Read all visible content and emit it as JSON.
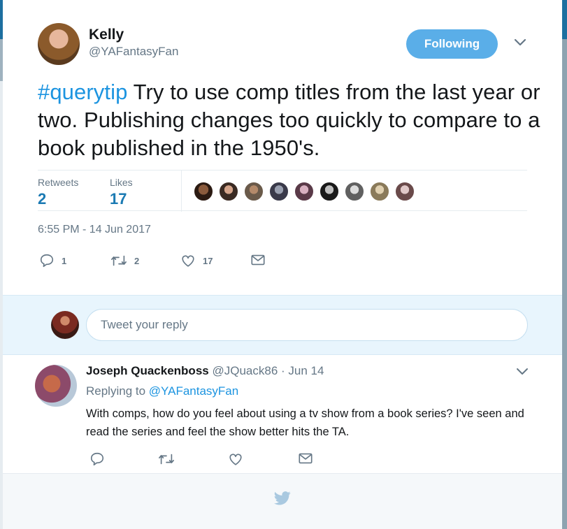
{
  "tweet": {
    "author_name": "Kelly",
    "author_handle": "@YAFantasyFan",
    "follow_button": "Following",
    "hashtag": "#querytip",
    "text": " Try to use comp titles from the last year or two. Publishing changes too quickly to compare to a book published in the 1950's.",
    "retweets_label": "Retweets",
    "retweets_count": "2",
    "likes_label": "Likes",
    "likes_count": "17",
    "likers_count": 9,
    "timestamp": "6:55 PM - 14 Jun 2017",
    "actions": {
      "reply_count": "1",
      "retweet_count": "2",
      "like_count": "17"
    }
  },
  "reply_box": {
    "placeholder": "Tweet your reply"
  },
  "reply": {
    "author_name": "Joseph Quackenboss",
    "author_handle": "@JQuack86",
    "separator": "·",
    "date": "Jun 14",
    "replying_prefix": "Replying to ",
    "replying_to": "@YAFantasyFan",
    "text": "With comps, how do you feel about using a tv show from a book series? I've seen and read the series and feel the show better hits the TA."
  },
  "colors": {
    "accent": "#1c94e0",
    "follow_button": "#5aaee8",
    "muted_text": "#657786",
    "stat_count": "#1b7ab3"
  },
  "icons": [
    "chevron-down-icon",
    "reply-icon",
    "retweet-icon",
    "heart-icon",
    "envelope-icon",
    "twitter-bird-icon"
  ]
}
